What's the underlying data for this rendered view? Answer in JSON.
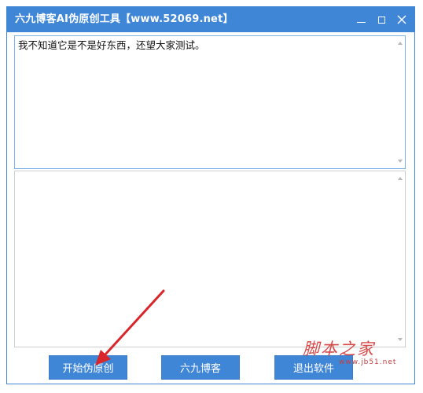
{
  "window": {
    "title": "六九博客AI伪原创工具【www.52069.net】"
  },
  "input": {
    "value": "我不知道它是不是好东西，还望大家测试。"
  },
  "output": {
    "value": ""
  },
  "buttons": {
    "start": "开始伪原创",
    "blog": "六九博客",
    "exit": "退出软件"
  },
  "watermark": {
    "title": "脚本之家",
    "url": "www.jb51.net"
  },
  "colors": {
    "accent": "#3f86d6",
    "arrow": "#d9262b"
  }
}
